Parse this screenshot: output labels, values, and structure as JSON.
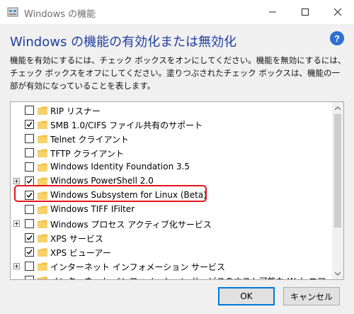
{
  "window": {
    "title": "Windows の機能",
    "controls": [
      "minimize",
      "maximize",
      "close"
    ]
  },
  "header": {
    "heading": "Windows の機能の有効化または無効化",
    "help_icon": "question-icon",
    "help_glyph": "?",
    "description": "機能を有効にするには、チェック ボックスをオンにしてください。機能を無効にするには、チェック ボックスをオフにしてください。塗りつぶされたチェック ボックスは、機能の一部が有効になっていることを表します。"
  },
  "features": [
    {
      "label": "RIP リスナー",
      "checked": false,
      "expandable": false
    },
    {
      "label": "SMB 1.0/CIFS ファイル共有のサポート",
      "checked": true,
      "expandable": false
    },
    {
      "label": "Telnet クライアント",
      "checked": false,
      "expandable": false
    },
    {
      "label": "TFTP クライアント",
      "checked": false,
      "expandable": false
    },
    {
      "label": "Windows Identity Foundation 3.5",
      "checked": false,
      "expandable": false
    },
    {
      "label": "Windows PowerShell 2.0",
      "checked": true,
      "expandable": true
    },
    {
      "label": "Windows Subsystem for Linux (Beta)",
      "checked": true,
      "expandable": false,
      "highlighted": true
    },
    {
      "label": "Windows TIFF IFilter",
      "checked": false,
      "expandable": false
    },
    {
      "label": "Windows プロセス アクティブ化サービス",
      "checked": false,
      "expandable": true
    },
    {
      "label": "XPS サービス",
      "checked": true,
      "expandable": false
    },
    {
      "label": "XPS ビューアー",
      "checked": true,
      "expandable": false
    },
    {
      "label": "インターネット インフォメーション サービス",
      "checked": false,
      "expandable": true
    },
    {
      "label": "インターネット インフォメーション サービスのホスト可能な Web コア",
      "checked": false,
      "expandable": false
    }
  ],
  "buttons": {
    "ok": "OK",
    "cancel": "キャンセル"
  },
  "colors": {
    "heading": "#1f3f9f",
    "highlight": "#e3141b",
    "folder": "#f2c14e",
    "ok_border": "#0078d7"
  }
}
